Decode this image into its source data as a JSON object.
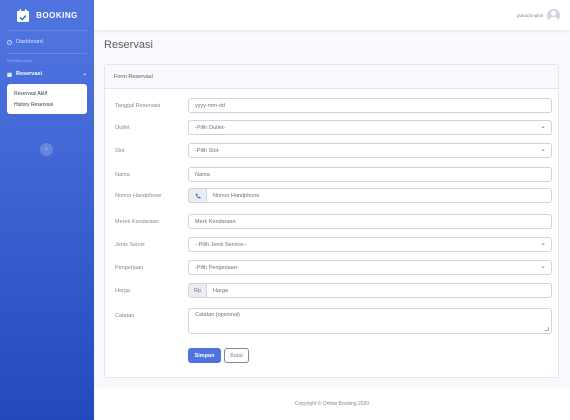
{
  "brand": {
    "name": "BOOKING"
  },
  "sidebar": {
    "dashboard_label": "Dashboard",
    "heading": "RAMBANGAN",
    "reservasi_label": "Reservasi",
    "submenu": [
      "Reservasi Aktif",
      "History Reservasi"
    ]
  },
  "topbar": {
    "username": "putradongkal"
  },
  "page": {
    "title": "Reservasi"
  },
  "form": {
    "header": "Form Reservasi",
    "tanggal": {
      "label": "Tanggal Reservasi",
      "placeholder": "yyyy-mm-dd"
    },
    "outlet": {
      "label": "Outlet",
      "selected": "-Pilih Outlet-"
    },
    "slot": {
      "label": "Slot",
      "selected": "-Pilih Slot-"
    },
    "nama": {
      "label": "Nama",
      "placeholder": "Nama"
    },
    "hp": {
      "label": "Nomor Handphone",
      "placeholder": "Nomor Handphone"
    },
    "merek": {
      "label": "Merek Kendaraan",
      "placeholder": "Merk Kendaraan"
    },
    "servis": {
      "label": "Jenis Servis",
      "selected": "--Pilih Jenis Service--"
    },
    "pengerjaan": {
      "label": "Pengerjaan",
      "selected": "-Pilih Pengerjaan-"
    },
    "harga": {
      "label": "Harga",
      "prefix": "Rp",
      "placeholder": "Harga"
    },
    "catatan": {
      "label": "Catatan",
      "placeholder": "Catatan (opsional)"
    },
    "submit_label": "Simpan",
    "cancel_label": "Batal"
  },
  "footer": {
    "text": "Copyright © Online Booking 2020"
  },
  "colors": {
    "primary": "#4e73df",
    "sidebar_dark": "#224abe"
  }
}
